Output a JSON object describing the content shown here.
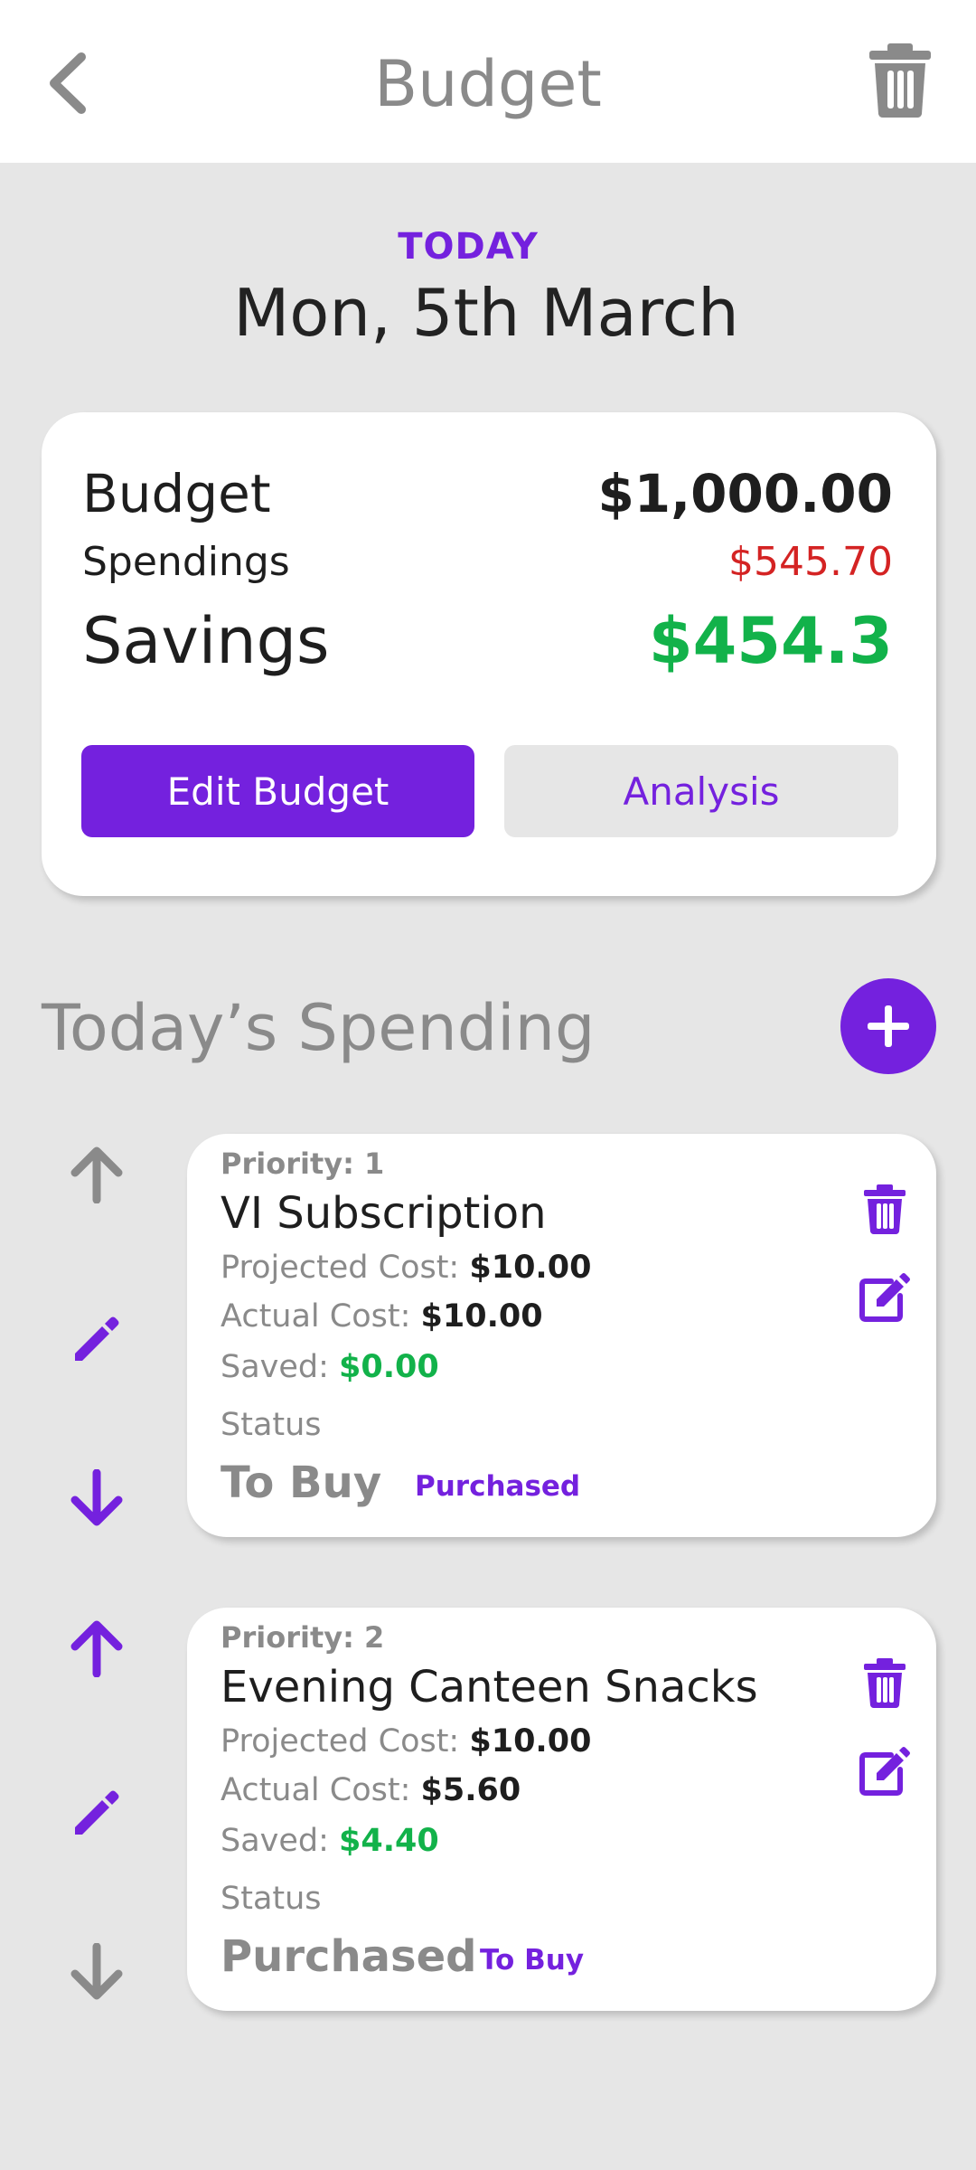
{
  "header": {
    "title": "Budget"
  },
  "date": {
    "label": "TODAY",
    "value": "Mon, 5th March"
  },
  "summary": {
    "budget_label": "Budget",
    "budget_value": "$1,000.00",
    "spendings_label": "Spendings",
    "spendings_value": "$545.70",
    "savings_label": "Savings",
    "savings_value": "$454.3",
    "edit_button": "Edit Budget",
    "analysis_button": "Analysis"
  },
  "section": {
    "title": "Today’s Spending"
  },
  "items": [
    {
      "priority": "Priority: 1",
      "name": "VI Subscription",
      "projected_label": "Projected Cost: ",
      "projected_value": "$10.00",
      "actual_label": "Actual Cost: ",
      "actual_value": "$10.00",
      "saved_label": "Saved: ",
      "saved_value": "$0.00",
      "status_label": "Status",
      "status_value": "To Buy",
      "status_action": "Purchased"
    },
    {
      "priority": "Priority: 2",
      "name": "Evening Canteen Snacks",
      "projected_label": "Projected Cost: ",
      "projected_value": "$10.00",
      "actual_label": "Actual Cost: ",
      "actual_value": "$5.60",
      "saved_label": "Saved: ",
      "saved_value": "$4.40",
      "status_label": "Status",
      "status_value": "Purchased",
      "status_action": "To Buy"
    }
  ],
  "icons": {
    "back": "chevron-left-icon",
    "delete_all": "trash-icon",
    "add": "plus-icon",
    "move_up": "arrow-up-icon",
    "move_down": "arrow-down-icon",
    "edit": "pencil-icon",
    "delete_item": "trash-icon",
    "edit_item": "edit-square-icon"
  },
  "colors": {
    "accent": "#7421de",
    "danger": "#d42323",
    "success": "#12b24a",
    "muted": "#8a8a8a",
    "background": "#e6e6e6"
  }
}
